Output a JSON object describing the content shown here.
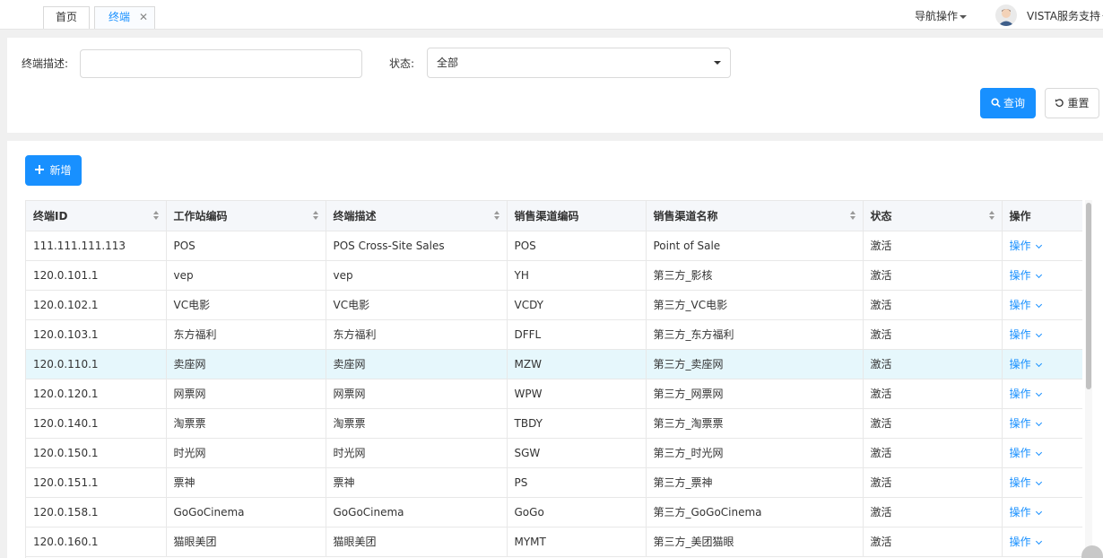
{
  "tabs": [
    {
      "label": "首页"
    },
    {
      "label": "终端",
      "close": "✕"
    }
  ],
  "header": {
    "nav_operations": "导航操作",
    "user_name": "VISTA服务支持"
  },
  "search": {
    "desc_label": "终端描述:",
    "desc_value": "",
    "status_label": "状态:",
    "status_value": "全部",
    "query_button": "查询",
    "reset_button": "重置"
  },
  "toolbar": {
    "add_button": "新增"
  },
  "table": {
    "columns": [
      "终端ID",
      "工作站编码",
      "终端描述",
      "销售渠道编码",
      "销售渠道名称",
      "状态",
      "操作"
    ],
    "rows": [
      [
        "111.111.111.113",
        "POS",
        "POS Cross-Site Sales",
        "POS",
        "Point of Sale",
        "激活",
        "操作"
      ],
      [
        "120.0.101.1",
        "vep",
        "vep",
        "YH",
        "第三方_影核",
        "激活",
        "操作"
      ],
      [
        "120.0.102.1",
        "VC电影",
        "VC电影",
        "VCDY",
        "第三方_VC电影",
        "激活",
        "操作"
      ],
      [
        "120.0.103.1",
        "东方福利",
        "东方福利",
        "DFFL",
        "第三方_东方福利",
        "激活",
        "操作"
      ],
      [
        "120.0.110.1",
        "卖座网",
        "卖座网",
        "MZW",
        "第三方_卖座网",
        "激活",
        "操作"
      ],
      [
        "120.0.120.1",
        "网票网",
        "网票网",
        "WPW",
        "第三方_网票网",
        "激活",
        "操作"
      ],
      [
        "120.0.140.1",
        "淘票票",
        "淘票票",
        "TBDY",
        "第三方_淘票票",
        "激活",
        "操作"
      ],
      [
        "120.0.150.1",
        "时光网",
        "时光网",
        "SGW",
        "第三方_时光网",
        "激活",
        "操作"
      ],
      [
        "120.0.151.1",
        "票神",
        "票神",
        "PS",
        "第三方_票神",
        "激活",
        "操作"
      ],
      [
        "120.0.158.1",
        "GoGoCinema",
        "GoGoCinema",
        "GoGo",
        "第三方_GoGoCinema",
        "激活",
        "操作"
      ],
      [
        "120.0.160.1",
        "猫眼美团",
        "猫眼美团",
        "MYMT",
        "第三方_美团猫眼",
        "激活",
        "操作"
      ]
    ],
    "selected_row": 4
  },
  "colors": {
    "primary": "#1890ff",
    "selected_row": "#e6f7fc",
    "header_bg": "#f5f7fa"
  }
}
